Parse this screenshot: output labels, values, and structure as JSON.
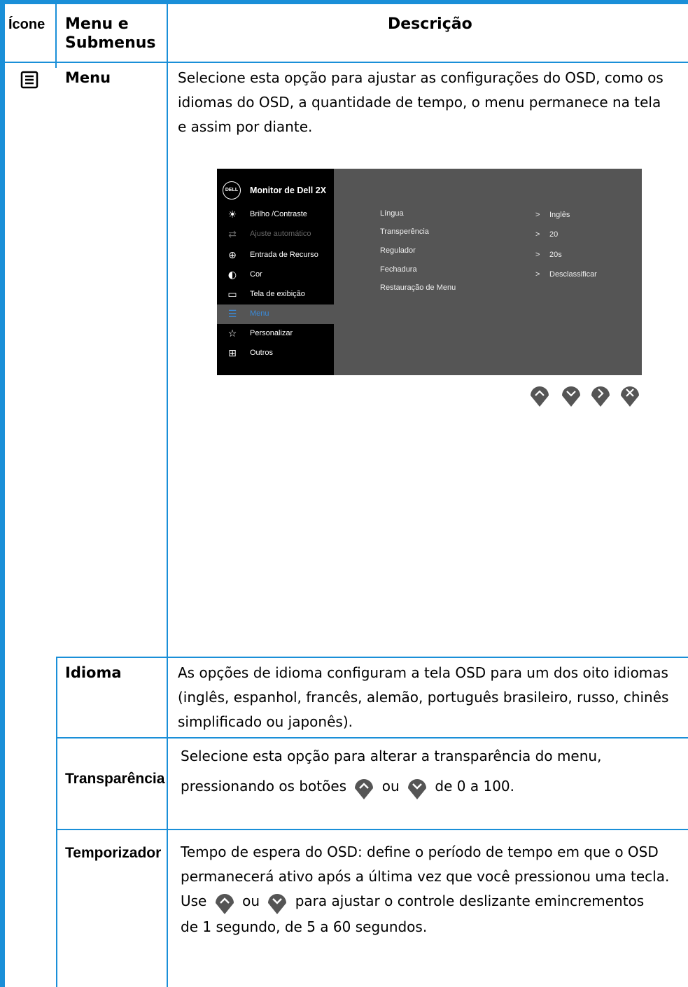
{
  "header": {
    "icone": "Ícone",
    "menu": "Menu e\nSubmenus",
    "descricao": "Descrição"
  },
  "rows": {
    "menu": {
      "icon": "menu-list-icon",
      "label": "Menu",
      "desc_lines": [
        "Selecione esta opção para ajustar as configurações do OSD, como os",
        "idiomas do OSD, a quantidade de tempo, o menu permanece na tela",
        "e assim por diante."
      ]
    },
    "idioma": {
      "label": "Idioma",
      "desc_lines": [
        "As opções de idioma configuram a tela OSD para um dos oito idiomas",
        "(inglês, espanhol, francês, alemão, português brasileiro, russo, chinês",
        "simplificado ou japonês)."
      ]
    },
    "transparencia": {
      "label": "Transparência",
      "line1": "Selecione esta opção para alterar a transparência do menu,",
      "line2_a": "pressionando os botões",
      "line2_b": "ou",
      "line2_c": "de 0 a 100."
    },
    "temporizador": {
      "label": "Temporizador",
      "line1": "Tempo de espera do OSD: define o período de tempo em que o OSD",
      "line2": "permanecerá ativo após a última vez que você pressionou uma tecla.",
      "line3_a": "Use",
      "line3_b": "ou",
      "line3_c": "para ajustar o controle deslizante emincrementos",
      "line4": "de 1 segundo, de 5 a 60 segundos."
    }
  },
  "osd": {
    "logo": "DELL",
    "title": "Monitor de Dell 2X",
    "items": [
      {
        "icon": "brightness-icon",
        "label": "Brilho /Contraste",
        "state": "normal"
      },
      {
        "icon": "auto-adjust-icon",
        "label": "Ajuste automático",
        "state": "dim"
      },
      {
        "icon": "input-source-icon",
        "label": "Entrada de Recurso",
        "state": "normal"
      },
      {
        "icon": "color-icon",
        "label": "Cor",
        "state": "normal"
      },
      {
        "icon": "display-icon",
        "label": "Tela de exibição",
        "state": "normal"
      },
      {
        "icon": "menu-icon",
        "label": "Menu",
        "state": "selected"
      },
      {
        "icon": "star-icon",
        "label": "Personalizar",
        "state": "normal"
      },
      {
        "icon": "others-icon",
        "label": "Outros",
        "state": "normal"
      }
    ],
    "submenu": [
      "Língua",
      "Transperência",
      "Regulador",
      "Fechadura",
      "Restauração de Menu"
    ],
    "values": [
      {
        "arrow": ">",
        "value": "Inglês"
      },
      {
        "arrow": ">",
        "value": "20"
      },
      {
        "arrow": ">",
        "value": "20s"
      },
      {
        "arrow": ">",
        "value": "Desclassificar"
      }
    ],
    "nav_buttons": [
      "up-icon",
      "down-icon",
      "right-icon",
      "close-icon"
    ]
  },
  "colors": {
    "accent": "#1a8fd8",
    "osd_bg": "#555555",
    "osd_menu": "#000000",
    "selected": "#3a8ad8"
  }
}
